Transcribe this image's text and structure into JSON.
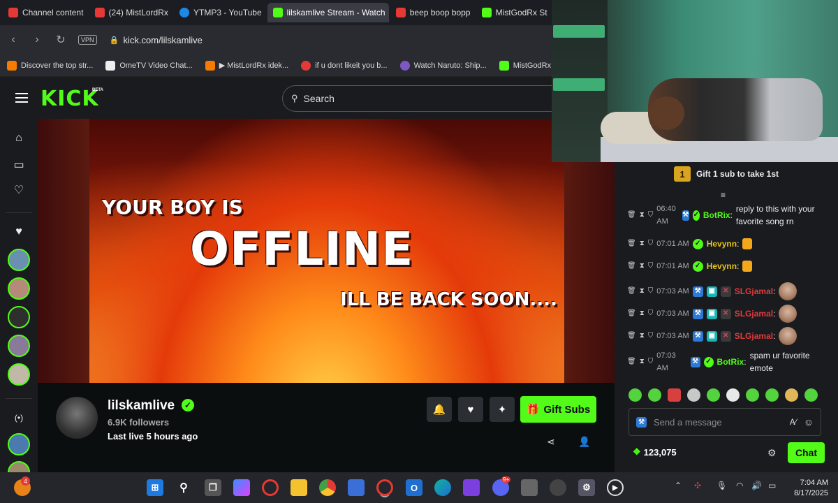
{
  "browser": {
    "tabs": [
      {
        "label": "Channel content",
        "color": "#e53935"
      },
      {
        "label": "(24) MistLordRx",
        "color": "#e53935"
      },
      {
        "label": "YTMP3 - YouTube",
        "color": "#1e88e5"
      },
      {
        "label": "lilskamlive Stream - Watch",
        "color": "#53fc18",
        "active": true
      },
      {
        "label": "beep boop bopp",
        "color": "#e53935"
      },
      {
        "label": "MistGodRx St",
        "color": "#53fc18"
      }
    ],
    "vpn_label": "VPN",
    "url": "kick.com/lilskamlive",
    "bookmarks": [
      {
        "label": "Discover the top str...",
        "color": "#f57c00"
      },
      {
        "label": "OmeTV Video Chat...",
        "color": "#ffffff"
      },
      {
        "label": "▶ MistLordRx idek...",
        "color": "#f57c00"
      },
      {
        "label": "if u dont likeit you b...",
        "color": "#e53935"
      },
      {
        "label": "Watch Naruto: Ship...",
        "color": "#7e57c2"
      },
      {
        "label": "MistGodRx",
        "color": "#53fc18"
      }
    ]
  },
  "kick": {
    "logo": "KICK",
    "logo_badge": "BETA",
    "search_placeholder": "Search"
  },
  "player": {
    "line1": "YOUR BOY IS",
    "line2": "OFFLINE",
    "line3": "ILL BE BACK SOON...."
  },
  "channel": {
    "name": "lilskamlive",
    "followers": "6.9K followers",
    "last_live": "Last live 5 hours ago",
    "gift_subs_label": "Gift Subs",
    "accent": "#53fc18"
  },
  "chat": {
    "gift_badge": "1",
    "gift_text": "Gift 1 sub to take 1st",
    "messages": [
      {
        "time": "06:40 AM",
        "user": "BotRix",
        "user_color": "#53fc18",
        "text": "reply to this with your favorite song rn"
      },
      {
        "time": "07:01 AM",
        "user": "Hevynn",
        "user_color": "#e6c619",
        "text": ""
      },
      {
        "time": "07:01 AM",
        "user": "Hevynn",
        "user_color": "#e6c619",
        "text": ""
      },
      {
        "time": "07:03 AM",
        "user": "SLGjamal",
        "user_color": "#e23b3b",
        "text": ""
      },
      {
        "time": "07:03 AM",
        "user": "SLGjamal",
        "user_color": "#e23b3b",
        "text": ""
      },
      {
        "time": "07:03 AM",
        "user": "SLGjamal",
        "user_color": "#e23b3b",
        "text": ""
      },
      {
        "time": "07:03 AM",
        "user": "BotRix",
        "user_color": "#53fc18",
        "text": "spam ur favorite emote"
      }
    ],
    "input_placeholder": "Send a message",
    "points": "123,075",
    "chat_button": "Chat"
  },
  "taskbar": {
    "notification_count": "4",
    "discord_badge": "9+",
    "time": "7:04 AM",
    "date": "8/17/2025"
  }
}
